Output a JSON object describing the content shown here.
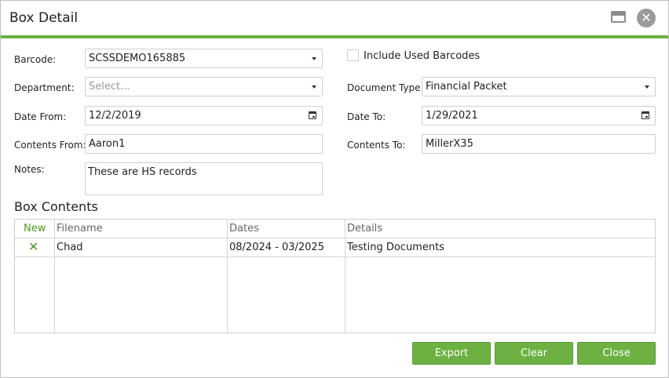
{
  "dialog": {
    "title": "Box Detail",
    "maximize_icon": "window-maximize-icon",
    "close_icon": "close-circle-icon",
    "close_glyph": "✕"
  },
  "form": {
    "barcode": {
      "label": "Barcode:",
      "value": "SCSSDEMO165885"
    },
    "include_used": {
      "label": "Include Used Barcodes",
      "checked": false
    },
    "department": {
      "label": "Department:",
      "placeholder": "Select..."
    },
    "document_type": {
      "label": "Document Type:",
      "value": "Financial Packet"
    },
    "date_from": {
      "label": "Date From:",
      "value": "12/2/2019"
    },
    "date_to": {
      "label": "Date To:",
      "value": "1/29/2021"
    },
    "contents_from": {
      "label": "Contents From:",
      "value": "Aaron1"
    },
    "contents_to": {
      "label": "Contents To:",
      "value": "MillerX35"
    },
    "notes": {
      "label": "Notes:",
      "value": "These are HS records"
    }
  },
  "box_contents": {
    "title": "Box Contents",
    "new_label": "New",
    "columns": [
      "Filename",
      "Dates",
      "Details"
    ],
    "rows": [
      {
        "delete_glyph": "✕",
        "filename": "Chad",
        "dates": "08/2024 - 03/2025",
        "details": "Testing Documents"
      }
    ]
  },
  "buttons": {
    "export": "Export",
    "clear": "Clear",
    "close": "Close"
  },
  "colors": {
    "accent": "#6cb142",
    "link": "#4e9a2a"
  }
}
